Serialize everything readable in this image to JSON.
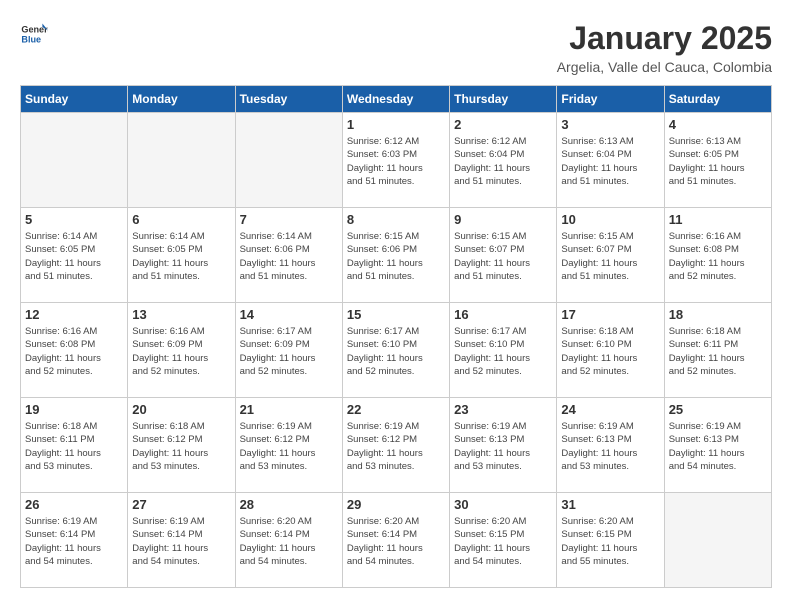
{
  "header": {
    "logo_general": "General",
    "logo_blue": "Blue",
    "title": "January 2025",
    "subtitle": "Argelia, Valle del Cauca, Colombia"
  },
  "weekdays": [
    "Sunday",
    "Monday",
    "Tuesday",
    "Wednesday",
    "Thursday",
    "Friday",
    "Saturday"
  ],
  "weeks": [
    [
      {
        "day": "",
        "empty": true
      },
      {
        "day": "",
        "empty": true
      },
      {
        "day": "",
        "empty": true
      },
      {
        "day": "1",
        "info": "Sunrise: 6:12 AM\nSunset: 6:03 PM\nDaylight: 11 hours\nand 51 minutes."
      },
      {
        "day": "2",
        "info": "Sunrise: 6:12 AM\nSunset: 6:04 PM\nDaylight: 11 hours\nand 51 minutes."
      },
      {
        "day": "3",
        "info": "Sunrise: 6:13 AM\nSunset: 6:04 PM\nDaylight: 11 hours\nand 51 minutes."
      },
      {
        "day": "4",
        "info": "Sunrise: 6:13 AM\nSunset: 6:05 PM\nDaylight: 11 hours\nand 51 minutes."
      }
    ],
    [
      {
        "day": "5",
        "info": "Sunrise: 6:14 AM\nSunset: 6:05 PM\nDaylight: 11 hours\nand 51 minutes."
      },
      {
        "day": "6",
        "info": "Sunrise: 6:14 AM\nSunset: 6:05 PM\nDaylight: 11 hours\nand 51 minutes."
      },
      {
        "day": "7",
        "info": "Sunrise: 6:14 AM\nSunset: 6:06 PM\nDaylight: 11 hours\nand 51 minutes."
      },
      {
        "day": "8",
        "info": "Sunrise: 6:15 AM\nSunset: 6:06 PM\nDaylight: 11 hours\nand 51 minutes."
      },
      {
        "day": "9",
        "info": "Sunrise: 6:15 AM\nSunset: 6:07 PM\nDaylight: 11 hours\nand 51 minutes."
      },
      {
        "day": "10",
        "info": "Sunrise: 6:15 AM\nSunset: 6:07 PM\nDaylight: 11 hours\nand 51 minutes."
      },
      {
        "day": "11",
        "info": "Sunrise: 6:16 AM\nSunset: 6:08 PM\nDaylight: 11 hours\nand 52 minutes."
      }
    ],
    [
      {
        "day": "12",
        "info": "Sunrise: 6:16 AM\nSunset: 6:08 PM\nDaylight: 11 hours\nand 52 minutes."
      },
      {
        "day": "13",
        "info": "Sunrise: 6:16 AM\nSunset: 6:09 PM\nDaylight: 11 hours\nand 52 minutes."
      },
      {
        "day": "14",
        "info": "Sunrise: 6:17 AM\nSunset: 6:09 PM\nDaylight: 11 hours\nand 52 minutes."
      },
      {
        "day": "15",
        "info": "Sunrise: 6:17 AM\nSunset: 6:10 PM\nDaylight: 11 hours\nand 52 minutes."
      },
      {
        "day": "16",
        "info": "Sunrise: 6:17 AM\nSunset: 6:10 PM\nDaylight: 11 hours\nand 52 minutes."
      },
      {
        "day": "17",
        "info": "Sunrise: 6:18 AM\nSunset: 6:10 PM\nDaylight: 11 hours\nand 52 minutes."
      },
      {
        "day": "18",
        "info": "Sunrise: 6:18 AM\nSunset: 6:11 PM\nDaylight: 11 hours\nand 52 minutes."
      }
    ],
    [
      {
        "day": "19",
        "info": "Sunrise: 6:18 AM\nSunset: 6:11 PM\nDaylight: 11 hours\nand 53 minutes."
      },
      {
        "day": "20",
        "info": "Sunrise: 6:18 AM\nSunset: 6:12 PM\nDaylight: 11 hours\nand 53 minutes."
      },
      {
        "day": "21",
        "info": "Sunrise: 6:19 AM\nSunset: 6:12 PM\nDaylight: 11 hours\nand 53 minutes."
      },
      {
        "day": "22",
        "info": "Sunrise: 6:19 AM\nSunset: 6:12 PM\nDaylight: 11 hours\nand 53 minutes."
      },
      {
        "day": "23",
        "info": "Sunrise: 6:19 AM\nSunset: 6:13 PM\nDaylight: 11 hours\nand 53 minutes."
      },
      {
        "day": "24",
        "info": "Sunrise: 6:19 AM\nSunset: 6:13 PM\nDaylight: 11 hours\nand 53 minutes."
      },
      {
        "day": "25",
        "info": "Sunrise: 6:19 AM\nSunset: 6:13 PM\nDaylight: 11 hours\nand 54 minutes."
      }
    ],
    [
      {
        "day": "26",
        "info": "Sunrise: 6:19 AM\nSunset: 6:14 PM\nDaylight: 11 hours\nand 54 minutes."
      },
      {
        "day": "27",
        "info": "Sunrise: 6:19 AM\nSunset: 6:14 PM\nDaylight: 11 hours\nand 54 minutes."
      },
      {
        "day": "28",
        "info": "Sunrise: 6:20 AM\nSunset: 6:14 PM\nDaylight: 11 hours\nand 54 minutes."
      },
      {
        "day": "29",
        "info": "Sunrise: 6:20 AM\nSunset: 6:14 PM\nDaylight: 11 hours\nand 54 minutes."
      },
      {
        "day": "30",
        "info": "Sunrise: 6:20 AM\nSunset: 6:15 PM\nDaylight: 11 hours\nand 54 minutes."
      },
      {
        "day": "31",
        "info": "Sunrise: 6:20 AM\nSunset: 6:15 PM\nDaylight: 11 hours\nand 55 minutes."
      },
      {
        "day": "",
        "empty": true
      }
    ]
  ]
}
